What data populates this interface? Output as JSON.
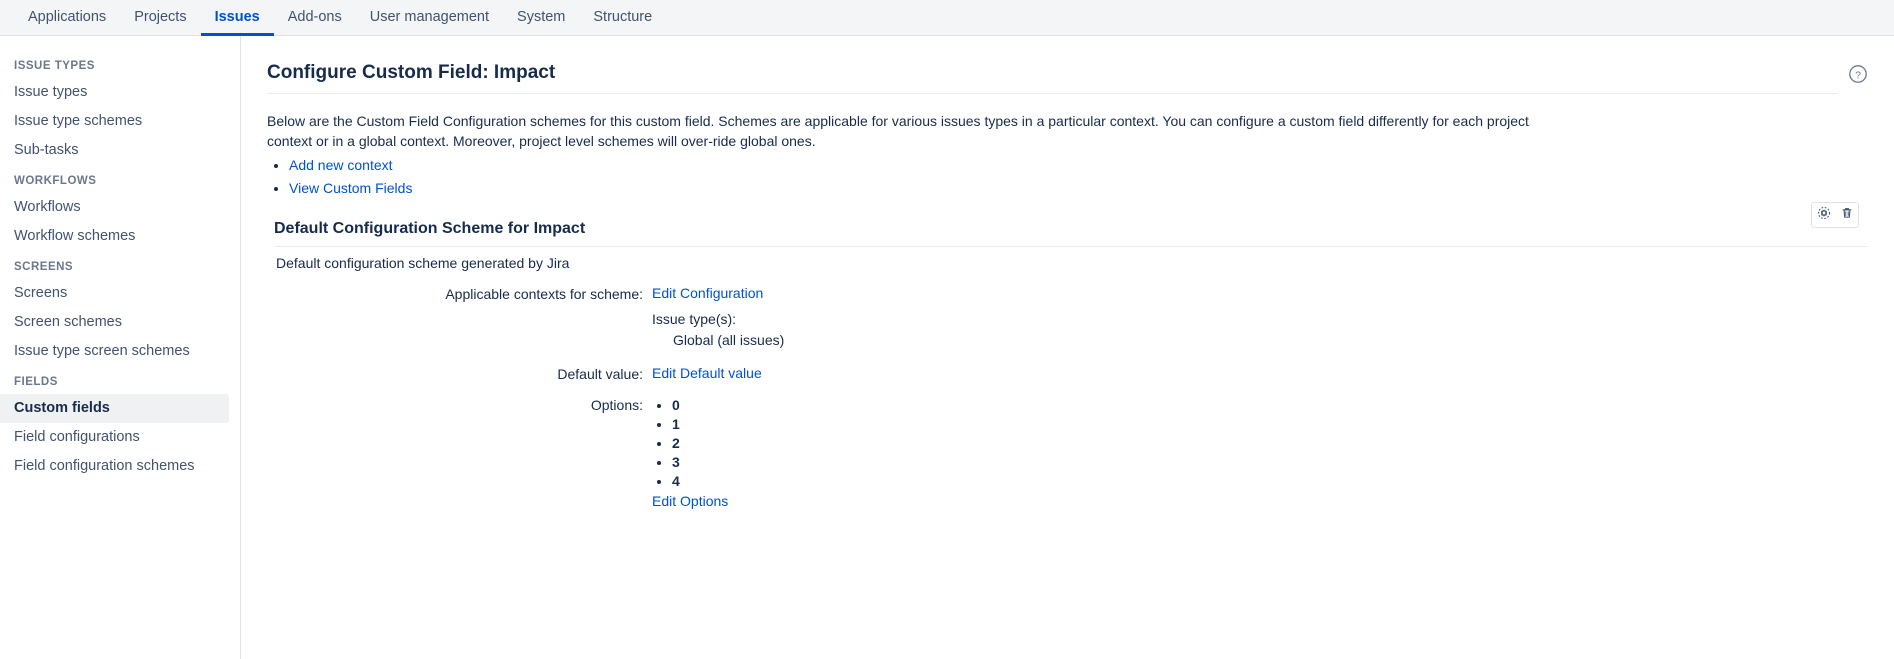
{
  "topnav": {
    "items": [
      {
        "label": "Applications",
        "active": false
      },
      {
        "label": "Projects",
        "active": false
      },
      {
        "label": "Issues",
        "active": true
      },
      {
        "label": "Add-ons",
        "active": false
      },
      {
        "label": "User management",
        "active": false
      },
      {
        "label": "System",
        "active": false
      },
      {
        "label": "Structure",
        "active": false
      }
    ]
  },
  "sidebar": {
    "sections": [
      {
        "title": "ISSUE TYPES",
        "items": [
          {
            "label": "Issue types",
            "selected": false
          },
          {
            "label": "Issue type schemes",
            "selected": false
          },
          {
            "label": "Sub-tasks",
            "selected": false
          }
        ]
      },
      {
        "title": "WORKFLOWS",
        "items": [
          {
            "label": "Workflows",
            "selected": false
          },
          {
            "label": "Workflow schemes",
            "selected": false
          }
        ]
      },
      {
        "title": "SCREENS",
        "items": [
          {
            "label": "Screens",
            "selected": false
          },
          {
            "label": "Screen schemes",
            "selected": false
          },
          {
            "label": "Issue type screen schemes",
            "selected": false
          }
        ]
      },
      {
        "title": "FIELDS",
        "items": [
          {
            "label": "Custom fields",
            "selected": true
          },
          {
            "label": "Field configurations",
            "selected": false
          },
          {
            "label": "Field configuration schemes",
            "selected": false
          }
        ]
      }
    ]
  },
  "main": {
    "page_title": "Configure Custom Field: Impact",
    "help_icon": "help-circle-icon",
    "intro_text": "Below are the Custom Field Configuration schemes for this custom field. Schemes are applicable for various issues types in a particular context. You can configure a custom field differently for each project context or in a global context. Moreover, project level schemes will over-ride global ones.",
    "links": [
      {
        "label": "Add new context"
      },
      {
        "label": "View Custom Fields"
      }
    ],
    "scheme": {
      "toolbar": [
        {
          "icon": "gear-icon",
          "name": "configure-scheme-button"
        },
        {
          "icon": "trash-icon",
          "name": "delete-scheme-button"
        }
      ],
      "title": "Default Configuration Scheme for Impact",
      "description": "Default configuration scheme generated by Jira",
      "rows": [
        {
          "label": "Applicable contexts for scheme:",
          "link": "Edit Configuration",
          "sub_title": "Issue type(s):",
          "sub_value": "Global (all issues)"
        },
        {
          "label": "Default value:",
          "link": "Edit Default value"
        },
        {
          "label": "Options:",
          "options": [
            "0",
            "1",
            "2",
            "3",
            "4"
          ],
          "options_link": "Edit Options"
        }
      ]
    }
  },
  "colors": {
    "link": "#0052cc",
    "text": "#172b4d",
    "muted": "#6b778c",
    "nav_bg": "#f4f5f7",
    "border": "#dfe1e6",
    "selected_bg": "#f0f1f3"
  }
}
